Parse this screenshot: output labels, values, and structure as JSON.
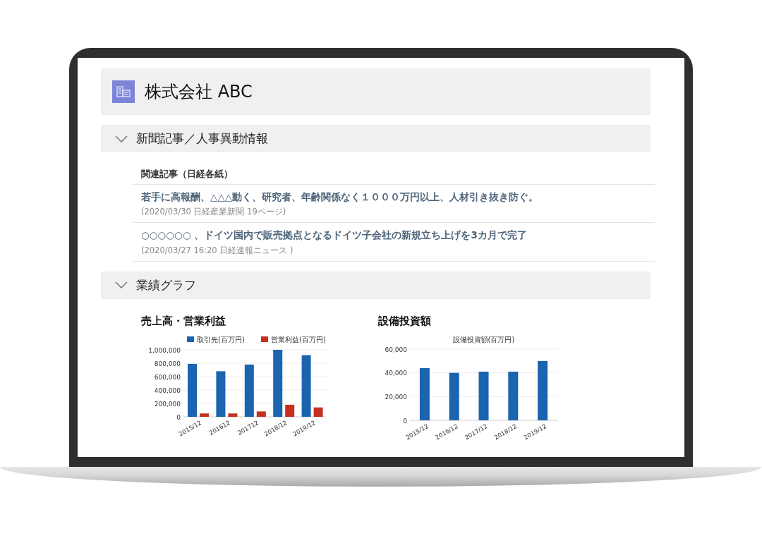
{
  "company": {
    "name": "株式会社 ABC"
  },
  "sections": [
    {
      "title": "新聞記事／人事異動情報",
      "expanded": true,
      "subheading": "関連記事（日経各紙）",
      "articles": [
        {
          "headline": "若手に高報酬、△△△動く、研究者、年齢関係なく１０００万円以上、人材引き抜き防ぐ。",
          "source": "(2020/03/30 日経産業新聞 19ページ)"
        },
        {
          "headline": "○○○○○○ 、ドイツ国内で販売拠点となるドイツ子会社の新規立ち上げを3カ月で完了",
          "source": "(2020/03/27 16:20 日経速報ニュース )"
        }
      ]
    },
    {
      "title": "業績グラフ",
      "expanded": true,
      "charts": [
        {
          "heading": "売上高・営業利益",
          "chart_data": {
            "type": "bar",
            "legend": true,
            "categories": [
              "2015/12",
              "201612",
              "201712",
              "2018/12",
              "2019/12"
            ],
            "series": [
              {
                "name": "取引先(百万円)",
                "color": "#1a64b0",
                "values": [
                  790000,
                  680000,
                  780000,
                  1000000,
                  920000
                ]
              },
              {
                "name": "営業利益(百万円)",
                "color": "#c5301f",
                "values": [
                  50000,
                  50000,
                  80000,
                  180000,
                  140000
                ]
              }
            ],
            "grid": true,
            "ylim": [
              0,
              1000000
            ],
            "yticks": [
              {
                "value": 0,
                "label": "0"
              },
              {
                "value": 200000,
                "label": "200,000"
              },
              {
                "value": 400000,
                "label": "400,000"
              },
              {
                "value": 600000,
                "label": "600,000"
              },
              {
                "value": 800000,
                "label": "800,000"
              },
              {
                "value": 1000000,
                "label": "1,000,000"
              }
            ]
          }
        },
        {
          "heading": "設備投資額",
          "chart_data": {
            "type": "bar",
            "title": "設備投資額(百万円)",
            "categories": [
              "2015/12",
              "2016/12",
              "2017/12",
              "2018/12",
              "2019/12"
            ],
            "series": [
              {
                "color": "#1a64b0",
                "values": [
                  44000,
                  40000,
                  41000,
                  41000,
                  50000
                ]
              }
            ],
            "grid": true,
            "ylim": [
              0,
              60000
            ],
            "yticks": [
              {
                "value": 0,
                "label": "0"
              },
              {
                "value": 20000,
                "label": "20,000"
              },
              {
                "value": 40000,
                "label": "40,000"
              },
              {
                "value": 60000,
                "label": "60,000"
              }
            ]
          }
        }
      ]
    }
  ]
}
